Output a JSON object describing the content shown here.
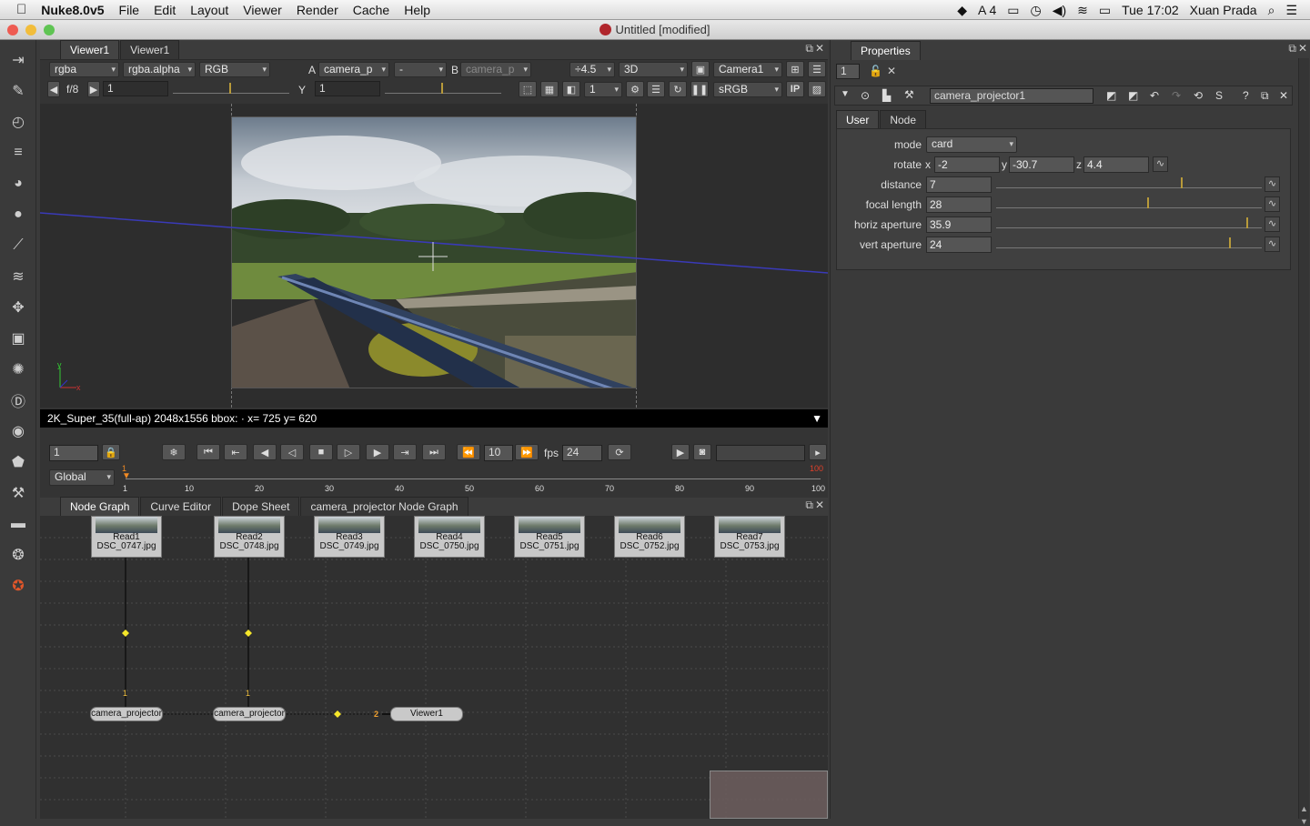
{
  "menubar": {
    "app_name": "Nuke8.0v5",
    "items": [
      "File",
      "Edit",
      "Layout",
      "Viewer",
      "Render",
      "Cache",
      "Help"
    ],
    "status_icons_text": "4",
    "clock": "Tue 17:02",
    "user": "Xuan Prada"
  },
  "window": {
    "title": "Untitled [modified]"
  },
  "viewer": {
    "tabs": [
      "Viewer1",
      "Viewer1"
    ],
    "channels": "rgba",
    "alpha": "rgba.alpha",
    "display": "RGB",
    "input_a_label": "A",
    "input_a": "camera_p",
    "op": "-",
    "input_b_label": "B",
    "input_b": "camera_p",
    "zoom": "÷4.5",
    "mode": "3D",
    "camera": "Camera1",
    "fstop": "f/8",
    "gain": "1",
    "gamma_label": "Y",
    "gamma": "1",
    "proxy": "1",
    "lut": "sRGB",
    "ip_label": "IP",
    "status_text": "2K_Super_35(full-ap) 2048x1556 bbox: ·  x= 725 y= 620"
  },
  "timeline": {
    "frame": "1",
    "increment": "10",
    "fps_label": "fps",
    "fps": "24",
    "range_mode": "Global",
    "ticks": [
      "1",
      "10",
      "20",
      "30",
      "40",
      "50",
      "60",
      "70",
      "80",
      "90",
      "100"
    ],
    "start_marker": "1",
    "end_marker": "100"
  },
  "nodegraph": {
    "tabs": [
      "Node Graph",
      "Curve Editor",
      "Dope Sheet",
      "camera_projector Node Graph"
    ],
    "reads": [
      {
        "name": "Read1",
        "file": "DSC_0747.jpg"
      },
      {
        "name": "Read2",
        "file": "DSC_0748.jpg"
      },
      {
        "name": "Read3",
        "file": "DSC_0749.jpg"
      },
      {
        "name": "Read4",
        "file": "DSC_0750.jpg"
      },
      {
        "name": "Read5",
        "file": "DSC_0751.jpg"
      },
      {
        "name": "Read6",
        "file": "DSC_0752.jpg"
      },
      {
        "name": "Read7",
        "file": "DSC_0753.jpg"
      }
    ],
    "projector1": "camera_projector",
    "projector2": "camera_projector",
    "pipe_label_1": "1",
    "pipe_label_2": "1",
    "input_number": "2",
    "viewer_node": "Viewer1"
  },
  "properties": {
    "title": "Properties",
    "max_panels": "1",
    "node_name": "camera_projector1",
    "tabs": [
      "User",
      "Node"
    ],
    "mode_label": "mode",
    "mode": "card",
    "rotate_label": "rotate",
    "rotate": {
      "x": "-2",
      "y": "-30.7",
      "z": "4.4"
    },
    "axes": [
      "x",
      "y",
      "z"
    ],
    "distance_label": "distance",
    "distance": "7",
    "focal_label": "focal length",
    "focal": "28",
    "haperture_label": "horiz aperture",
    "haperture": "35.9",
    "vaperture_label": "vert aperture",
    "vaperture": "24"
  },
  "colors": {
    "accent": "#f08a24",
    "panel": "#343434",
    "viewer_line": "#3a3ab8"
  }
}
